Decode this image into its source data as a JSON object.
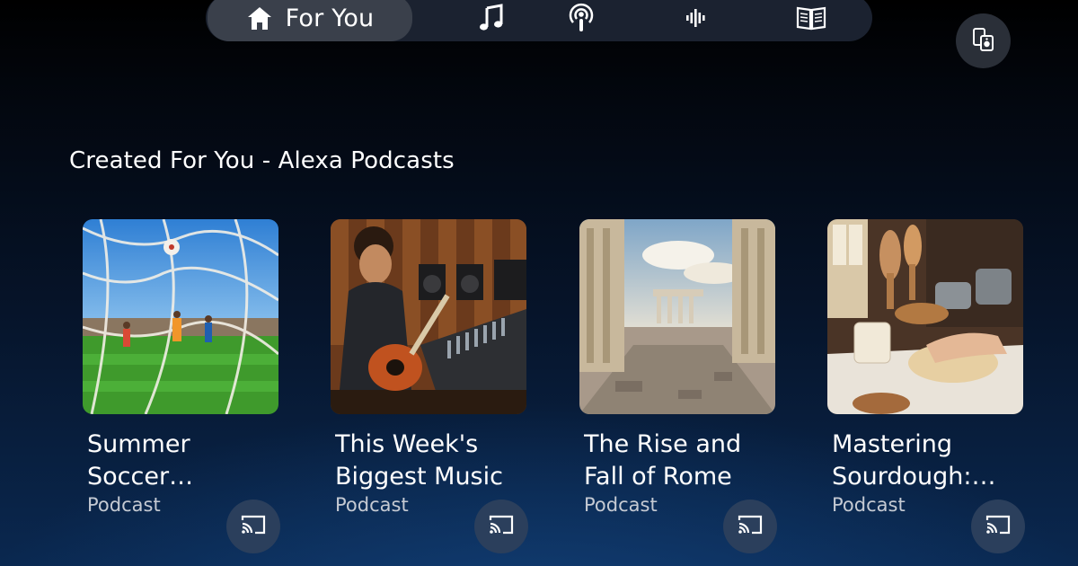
{
  "nav": {
    "items": [
      {
        "label": "For You",
        "icon": "home-icon",
        "active": true
      },
      {
        "icon": "music-note-icon"
      },
      {
        "icon": "podcast-icon"
      },
      {
        "icon": "audio-wave-icon"
      },
      {
        "icon": "book-icon"
      }
    ]
  },
  "corner_button": {
    "icon": "devices-icon"
  },
  "section": {
    "title": "Created For You - Alexa Podcasts",
    "cards": [
      {
        "title": "Summer Soccer Tournament",
        "subtitle": "Podcast",
        "image": "soccer-goal-image",
        "action_icon": "cast-icon"
      },
      {
        "title": "This Week's Biggest Music",
        "subtitle": "Podcast",
        "image": "guitarist-studio-image",
        "action_icon": "cast-icon"
      },
      {
        "title": "The Rise and Fall of Rome",
        "subtitle": "Podcast",
        "image": "roman-ruins-image",
        "action_icon": "cast-icon"
      },
      {
        "title": "Mastering Sourdough: Tips",
        "subtitle": "Podcast",
        "image": "bread-kneading-image",
        "action_icon": "cast-icon"
      }
    ]
  },
  "colors": {
    "accent": "#2b3f5c",
    "nav_bg": "#1b2230",
    "nav_active": "#3a404b"
  }
}
